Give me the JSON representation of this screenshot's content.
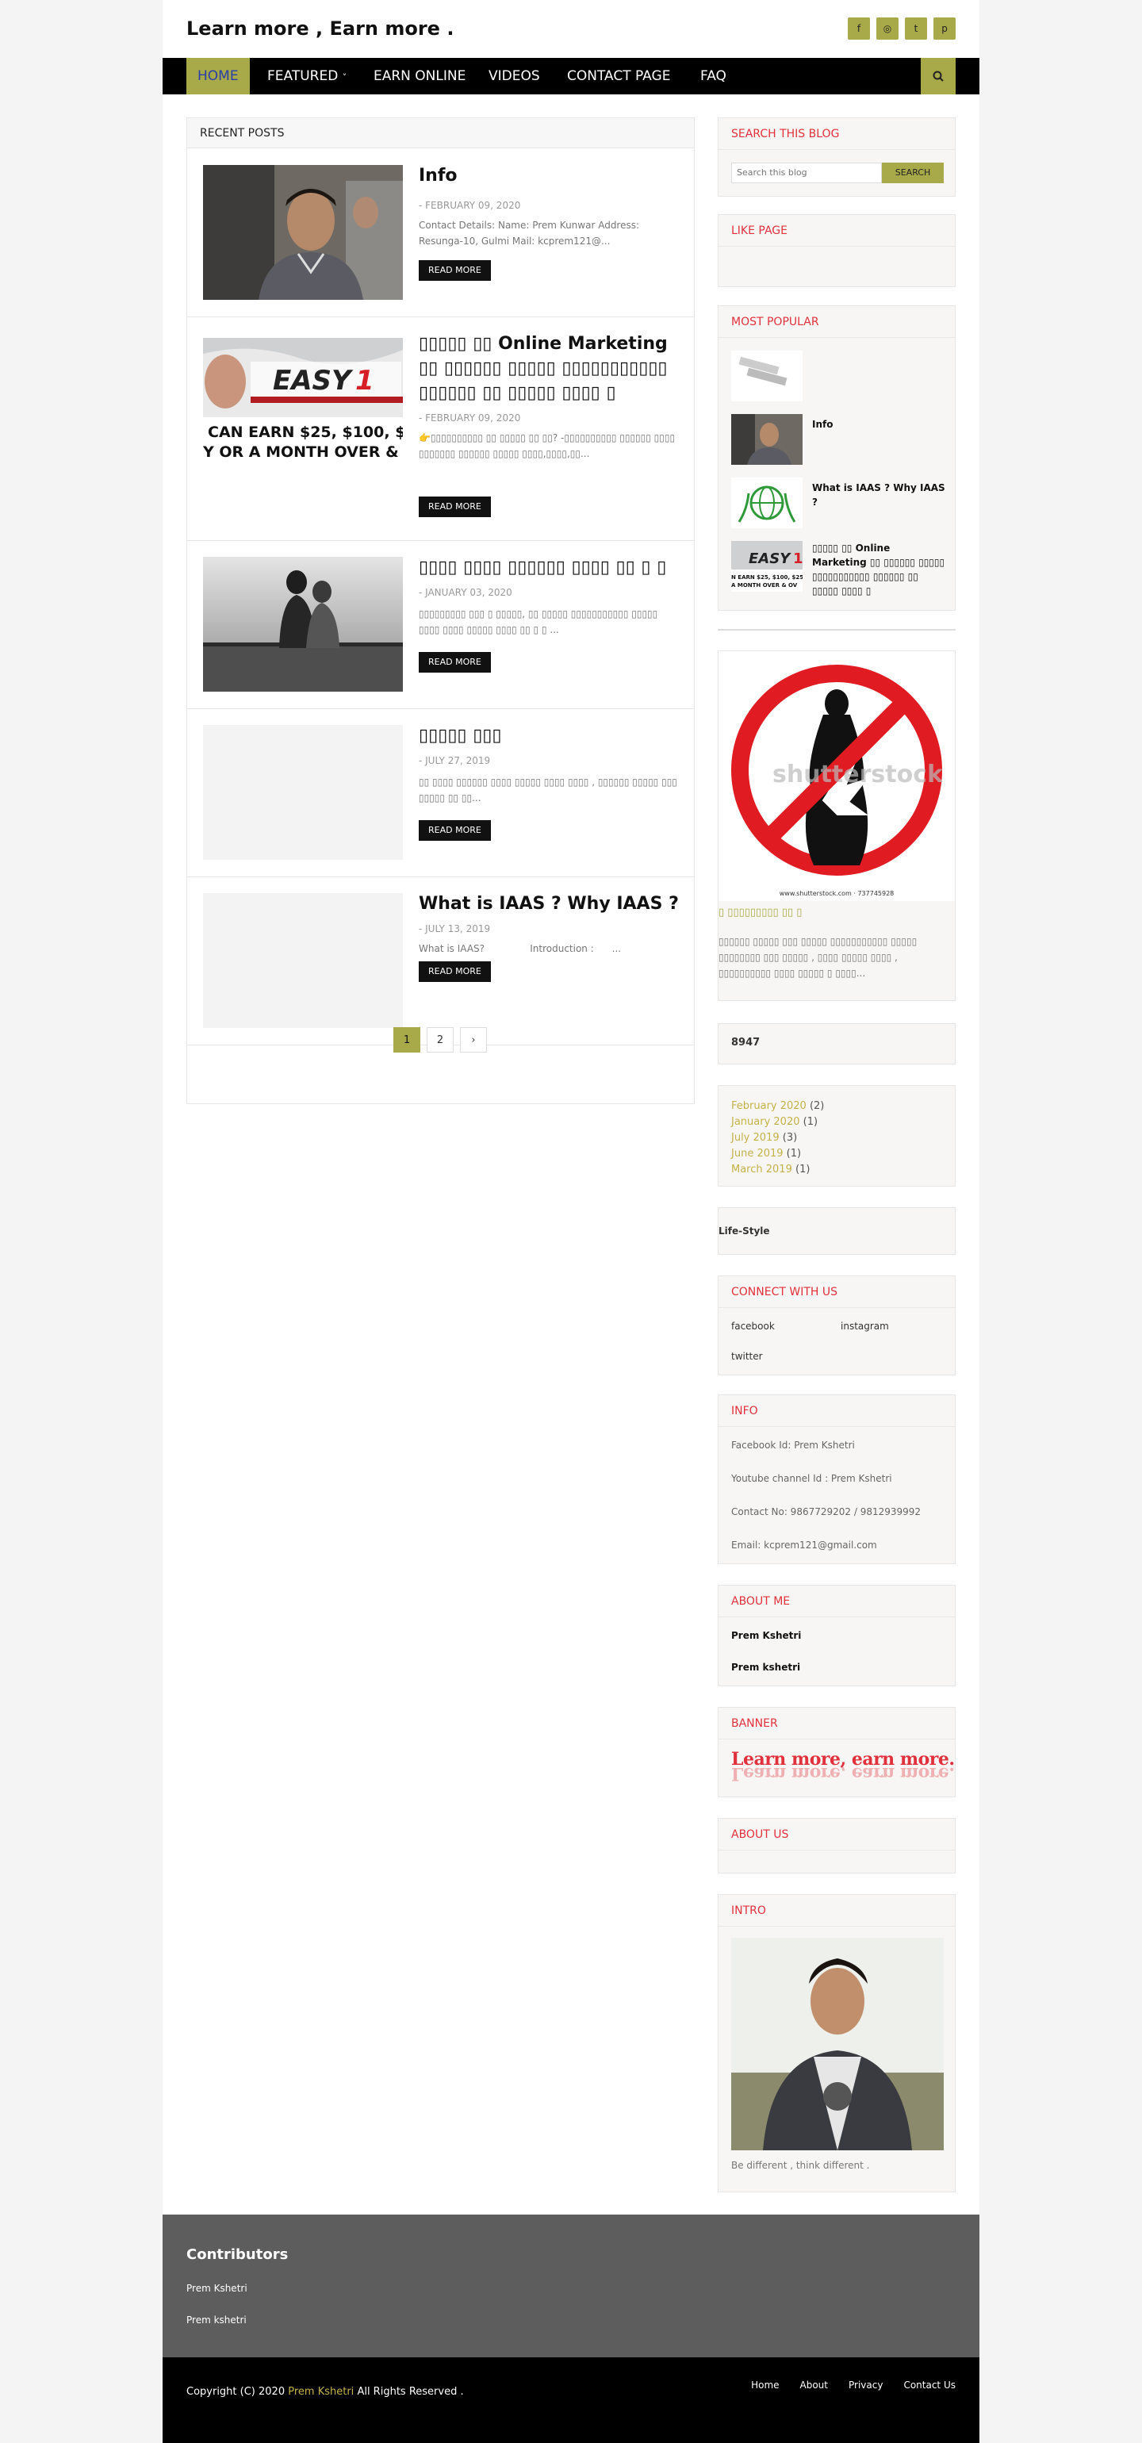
{
  "site": {
    "title": "Learn more , Earn more .",
    "social_icons": [
      "facebook-icon",
      "instagram-icon",
      "twitter-icon",
      "pinterest-icon"
    ]
  },
  "nav": {
    "items": [
      "HOME",
      "FEATURED",
      "EARN ONLINE",
      "VIDEOS",
      "CONTACT PAGE",
      "FAQ"
    ],
    "featured_caret": "˅",
    "search_icon": "search-icon"
  },
  "main": {
    "heading": "RECENT POSTS",
    "posts": [
      {
        "title": "Info",
        "date": "- FEBRUARY 09, 2020",
        "snippet": "Contact Details: Name: Prem Kunwar Address: Resunga-10, Gulmi Mail: kcprem121@...",
        "read_more": "READ MORE"
      },
      {
        "title": "▯▯▯▯▯ ▯▯ Online Marketing ▯▯ ▯▯▯▯▯▯ ▯▯▯▯▯ ▯▯▯▯▯▯▯▯▯▯▯ ▯▯▯▯▯▯ ▯▯ ▯▯▯▯▯ ▯▯▯▯ ▯",
        "date": "- FEBRUARY 09, 2020",
        "snippet": "👉▯▯▯▯▯▯▯▯▯▯ ▯▯ ▯▯▯▯▯ ▯▯ ▯▯? -▯▯▯▯▯▯▯▯▯▯ ▯▯▯▯▯▯ ▯▯▯▯ ▯▯▯▯▯▯▯ ▯▯▯▯▯▯ ▯▯▯▯▯ ▯▯▯▯,▯▯▯▯,▯▯...",
        "read_more": "READ MORE"
      },
      {
        "title": "▯▯▯▯ ▯▯▯▯ ▯▯▯▯▯▯ ▯▯▯▯ ▯▯ ▯ ▯",
        "date": "- JANUARY 03, 2020",
        "snippet": "▯▯▯▯▯▯▯▯▯ ▯▯▯ ▯ ▯▯▯▯▯, ▯▯ ▯▯▯▯▯ ▯▯▯▯▯▯▯▯▯▯▯ ▯▯▯▯▯ ▯▯▯▯ ▯▯▯▯ ▯▯▯▯▯ ▯▯▯▯ ▯▯ ▯ ▯ ...",
        "read_more": "READ MORE"
      },
      {
        "title": "▯▯▯▯▯ ▯▯▯",
        "date": "- JULY 27, 2019",
        "snippet": "▯▯ ▯▯▯▯ ▯▯▯▯▯▯ ▯▯▯▯ ▯▯▯▯▯ ▯▯▯▯ ▯▯▯▯ , ▯▯▯▯▯▯ ▯▯▯▯▯ ▯▯▯ ▯▯▯▯▯ ▯▯ ▯▯...",
        "read_more": "READ MORE"
      },
      {
        "title": "What is IAAS ? Why IAAS ?",
        "date": "- JULY 13, 2019",
        "snippet": "What is IAAS?               Introduction :      ...",
        "read_more": "READ MORE"
      }
    ],
    "pager": [
      "1",
      "2",
      "›"
    ]
  },
  "sidebar": {
    "search": {
      "title": "SEARCH THIS BLOG",
      "placeholder": "Search this blog",
      "button": "SEARCH"
    },
    "like_page": {
      "title": "LIKE PAGE"
    },
    "popular": {
      "title": "MOST POPULAR",
      "items": [
        {
          "title": ""
        },
        {
          "title": "Info"
        },
        {
          "title": "What is IAAS ? Why IAAS ?"
        },
        {
          "title": "▯▯▯▯▯ ▯▯ Online Marketing ▯▯ ▯▯▯▯▯▯ ▯▯▯▯▯ ▯▯▯▯▯▯▯▯▯▯▯ ▯▯▯▯▯▯ ▯▯ ▯▯▯▯▯ ▯▯▯▯ ▯"
        }
      ]
    },
    "featured_ad": {
      "watermark": "shutterstock",
      "stock_id": "www.shutterstock.com · 737745928",
      "caption": "▯ ▯▯▯▯▯▯▯▯▯ ▯▯ ▯",
      "text": "▯▯▯▯▯▯ ▯▯▯▯▯ ▯▯▯ ▯▯▯▯▯ ▯▯▯▯▯▯▯▯▯▯▯ ▯▯▯▯▯ ▯▯▯▯▯▯▯▯ ▯▯▯ ▯▯▯▯▯ , ▯▯▯▯ ▯▯▯▯▯ ▯▯▯▯ , ▯▯▯▯▯▯▯▯▯▯ ▯▯▯▯ ▯▯▯▯▯ ▯  ▯▯▯▯..."
    },
    "counter": "8947",
    "archive": [
      {
        "month": "February 2020",
        "count": "(2)"
      },
      {
        "month": "January 2020",
        "count": "(1)"
      },
      {
        "month": "July 2019",
        "count": "(3)"
      },
      {
        "month": "June 2019",
        "count": "(1)"
      },
      {
        "month": "March 2019",
        "count": "(1)"
      }
    ],
    "label": "Life-Style",
    "connect": {
      "title": "CONNECT WITH US",
      "links": [
        "facebook",
        "instagram",
        "twitter"
      ]
    },
    "info": {
      "title": "INFO",
      "lines": [
        "Facebook Id: Prem Kshetri",
        "Youtube channel Id : Prem Kshetri",
        "Contact No: 9867729202 / 9812939992",
        "Email: kcprem121@gmail.com"
      ]
    },
    "about_me": {
      "title": "ABOUT ME",
      "names": [
        "Prem Kshetri",
        "Prem kshetri"
      ]
    },
    "banner": {
      "title": "BANNER",
      "text": "Learn more, earn more."
    },
    "about_us": {
      "title": "ABOUT US"
    },
    "intro": {
      "title": "INTRO",
      "caption": "Be different , think different ."
    }
  },
  "footer": {
    "contributors_title": "Contributors",
    "contributors": [
      "Prem Kshetri",
      "Prem kshetri"
    ],
    "copyright_prefix": "Copyright (C) 2020",
    "copyright_brand": "Prem Kshetri",
    "copyright_suffix": "All Rights Reserved .",
    "links": [
      "Home",
      "About",
      "Privacy",
      "Contact Us"
    ]
  },
  "colors": {
    "accent": "#a8a948",
    "widget_title": "#e0313c",
    "nav_bg": "#000000",
    "footer_grey": "#5d5d5d"
  }
}
